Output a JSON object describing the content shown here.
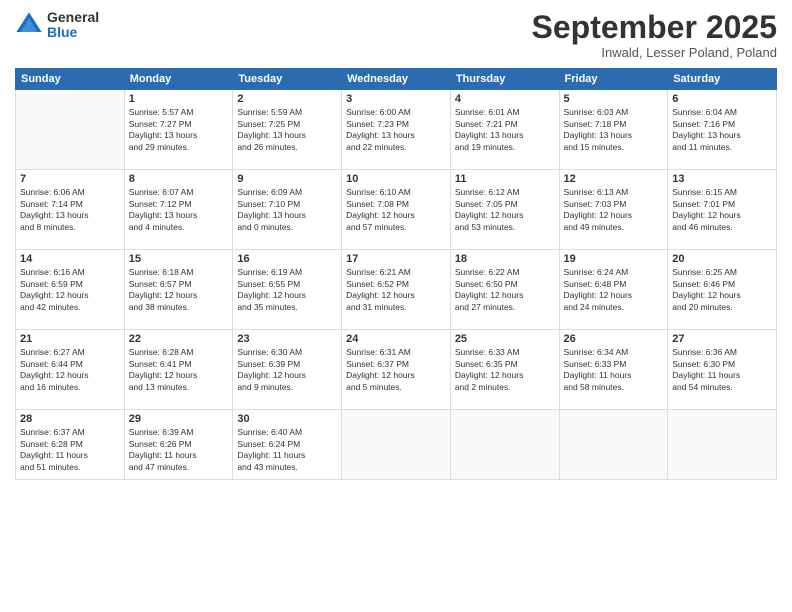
{
  "logo": {
    "general": "General",
    "blue": "Blue"
  },
  "header": {
    "month": "September 2025",
    "location": "Inwald, Lesser Poland, Poland"
  },
  "weekdays": [
    "Sunday",
    "Monday",
    "Tuesday",
    "Wednesday",
    "Thursday",
    "Friday",
    "Saturday"
  ],
  "weeks": [
    [
      {
        "day": "",
        "info": ""
      },
      {
        "day": "1",
        "info": "Sunrise: 5:57 AM\nSunset: 7:27 PM\nDaylight: 13 hours\nand 29 minutes."
      },
      {
        "day": "2",
        "info": "Sunrise: 5:59 AM\nSunset: 7:25 PM\nDaylight: 13 hours\nand 26 minutes."
      },
      {
        "day": "3",
        "info": "Sunrise: 6:00 AM\nSunset: 7:23 PM\nDaylight: 13 hours\nand 22 minutes."
      },
      {
        "day": "4",
        "info": "Sunrise: 6:01 AM\nSunset: 7:21 PM\nDaylight: 13 hours\nand 19 minutes."
      },
      {
        "day": "5",
        "info": "Sunrise: 6:03 AM\nSunset: 7:18 PM\nDaylight: 13 hours\nand 15 minutes."
      },
      {
        "day": "6",
        "info": "Sunrise: 6:04 AM\nSunset: 7:16 PM\nDaylight: 13 hours\nand 11 minutes."
      }
    ],
    [
      {
        "day": "7",
        "info": "Sunrise: 6:06 AM\nSunset: 7:14 PM\nDaylight: 13 hours\nand 8 minutes."
      },
      {
        "day": "8",
        "info": "Sunrise: 6:07 AM\nSunset: 7:12 PM\nDaylight: 13 hours\nand 4 minutes."
      },
      {
        "day": "9",
        "info": "Sunrise: 6:09 AM\nSunset: 7:10 PM\nDaylight: 13 hours\nand 0 minutes."
      },
      {
        "day": "10",
        "info": "Sunrise: 6:10 AM\nSunset: 7:08 PM\nDaylight: 12 hours\nand 57 minutes."
      },
      {
        "day": "11",
        "info": "Sunrise: 6:12 AM\nSunset: 7:05 PM\nDaylight: 12 hours\nand 53 minutes."
      },
      {
        "day": "12",
        "info": "Sunrise: 6:13 AM\nSunset: 7:03 PM\nDaylight: 12 hours\nand 49 minutes."
      },
      {
        "day": "13",
        "info": "Sunrise: 6:15 AM\nSunset: 7:01 PM\nDaylight: 12 hours\nand 46 minutes."
      }
    ],
    [
      {
        "day": "14",
        "info": "Sunrise: 6:16 AM\nSunset: 6:59 PM\nDaylight: 12 hours\nand 42 minutes."
      },
      {
        "day": "15",
        "info": "Sunrise: 6:18 AM\nSunset: 6:57 PM\nDaylight: 12 hours\nand 38 minutes."
      },
      {
        "day": "16",
        "info": "Sunrise: 6:19 AM\nSunset: 6:55 PM\nDaylight: 12 hours\nand 35 minutes."
      },
      {
        "day": "17",
        "info": "Sunrise: 6:21 AM\nSunset: 6:52 PM\nDaylight: 12 hours\nand 31 minutes."
      },
      {
        "day": "18",
        "info": "Sunrise: 6:22 AM\nSunset: 6:50 PM\nDaylight: 12 hours\nand 27 minutes."
      },
      {
        "day": "19",
        "info": "Sunrise: 6:24 AM\nSunset: 6:48 PM\nDaylight: 12 hours\nand 24 minutes."
      },
      {
        "day": "20",
        "info": "Sunrise: 6:25 AM\nSunset: 6:46 PM\nDaylight: 12 hours\nand 20 minutes."
      }
    ],
    [
      {
        "day": "21",
        "info": "Sunrise: 6:27 AM\nSunset: 6:44 PM\nDaylight: 12 hours\nand 16 minutes."
      },
      {
        "day": "22",
        "info": "Sunrise: 6:28 AM\nSunset: 6:41 PM\nDaylight: 12 hours\nand 13 minutes."
      },
      {
        "day": "23",
        "info": "Sunrise: 6:30 AM\nSunset: 6:39 PM\nDaylight: 12 hours\nand 9 minutes."
      },
      {
        "day": "24",
        "info": "Sunrise: 6:31 AM\nSunset: 6:37 PM\nDaylight: 12 hours\nand 5 minutes."
      },
      {
        "day": "25",
        "info": "Sunrise: 6:33 AM\nSunset: 6:35 PM\nDaylight: 12 hours\nand 2 minutes."
      },
      {
        "day": "26",
        "info": "Sunrise: 6:34 AM\nSunset: 6:33 PM\nDaylight: 11 hours\nand 58 minutes."
      },
      {
        "day": "27",
        "info": "Sunrise: 6:36 AM\nSunset: 6:30 PM\nDaylight: 11 hours\nand 54 minutes."
      }
    ],
    [
      {
        "day": "28",
        "info": "Sunrise: 6:37 AM\nSunset: 6:28 PM\nDaylight: 11 hours\nand 51 minutes."
      },
      {
        "day": "29",
        "info": "Sunrise: 6:39 AM\nSunset: 6:26 PM\nDaylight: 11 hours\nand 47 minutes."
      },
      {
        "day": "30",
        "info": "Sunrise: 6:40 AM\nSunset: 6:24 PM\nDaylight: 11 hours\nand 43 minutes."
      },
      {
        "day": "",
        "info": ""
      },
      {
        "day": "",
        "info": ""
      },
      {
        "day": "",
        "info": ""
      },
      {
        "day": "",
        "info": ""
      }
    ]
  ]
}
